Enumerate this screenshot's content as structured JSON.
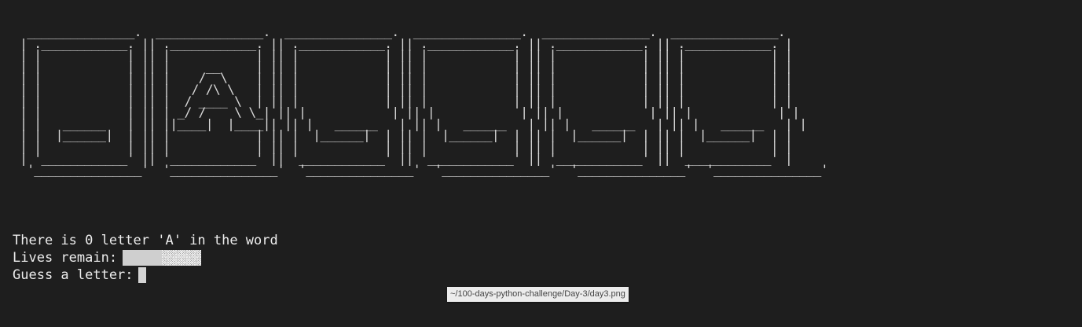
{
  "terminal": {
    "ascii_art": "  _______________.  _______________.  _______________.  _______________.  _______________.  _______________.\n | .____________. || .____________. || .____________. || .____________. || .____________. || .____________. |\n | |            | || |            | || |            | || |            | || |            | || |            | |\n | |            | || |     __     | || |            | || |            | || |            | || |            | |\n | |            | || |    /  \\    | || |            | || |            | || |            | || |            | |\n | |            | || |   / /\\ \\   | || |            | || |            | || |            | || |            | |\n | |            | || |  / ____ \\  | || |            | || |            | || |            | || |            | |\n | |            | || | _/ /    \\ \\_| || |            | || |            | || |            | || |            | |\n | |   ______   | || ||____|  |____|| || |   ______   | || |   ______   | || |   ______   | || |   ______   | |\n | |  |______|  | || |            | || |  |______|  | || |  |______|  | || |  |______|  | || |  |______|  | |\n | |            | || |            | || |            | || |            | || |            | || |            | |\n | '____________' || '____________' || '____________' || '____________' || '____________' || '____________' |\n  '_______________'  '_______________'  '_______________'  '_______________'  '_______________'  '_______________'",
    "status_line": "There is 0 letter 'A' in the word",
    "lives_label": "Lives remain: ",
    "lives_remaining": 1,
    "lives_total": 2,
    "guess_prompt": "Guess a letter: "
  },
  "tooltip": {
    "file_path": "~/100-days-python-challenge/Day-3/day3.png"
  }
}
